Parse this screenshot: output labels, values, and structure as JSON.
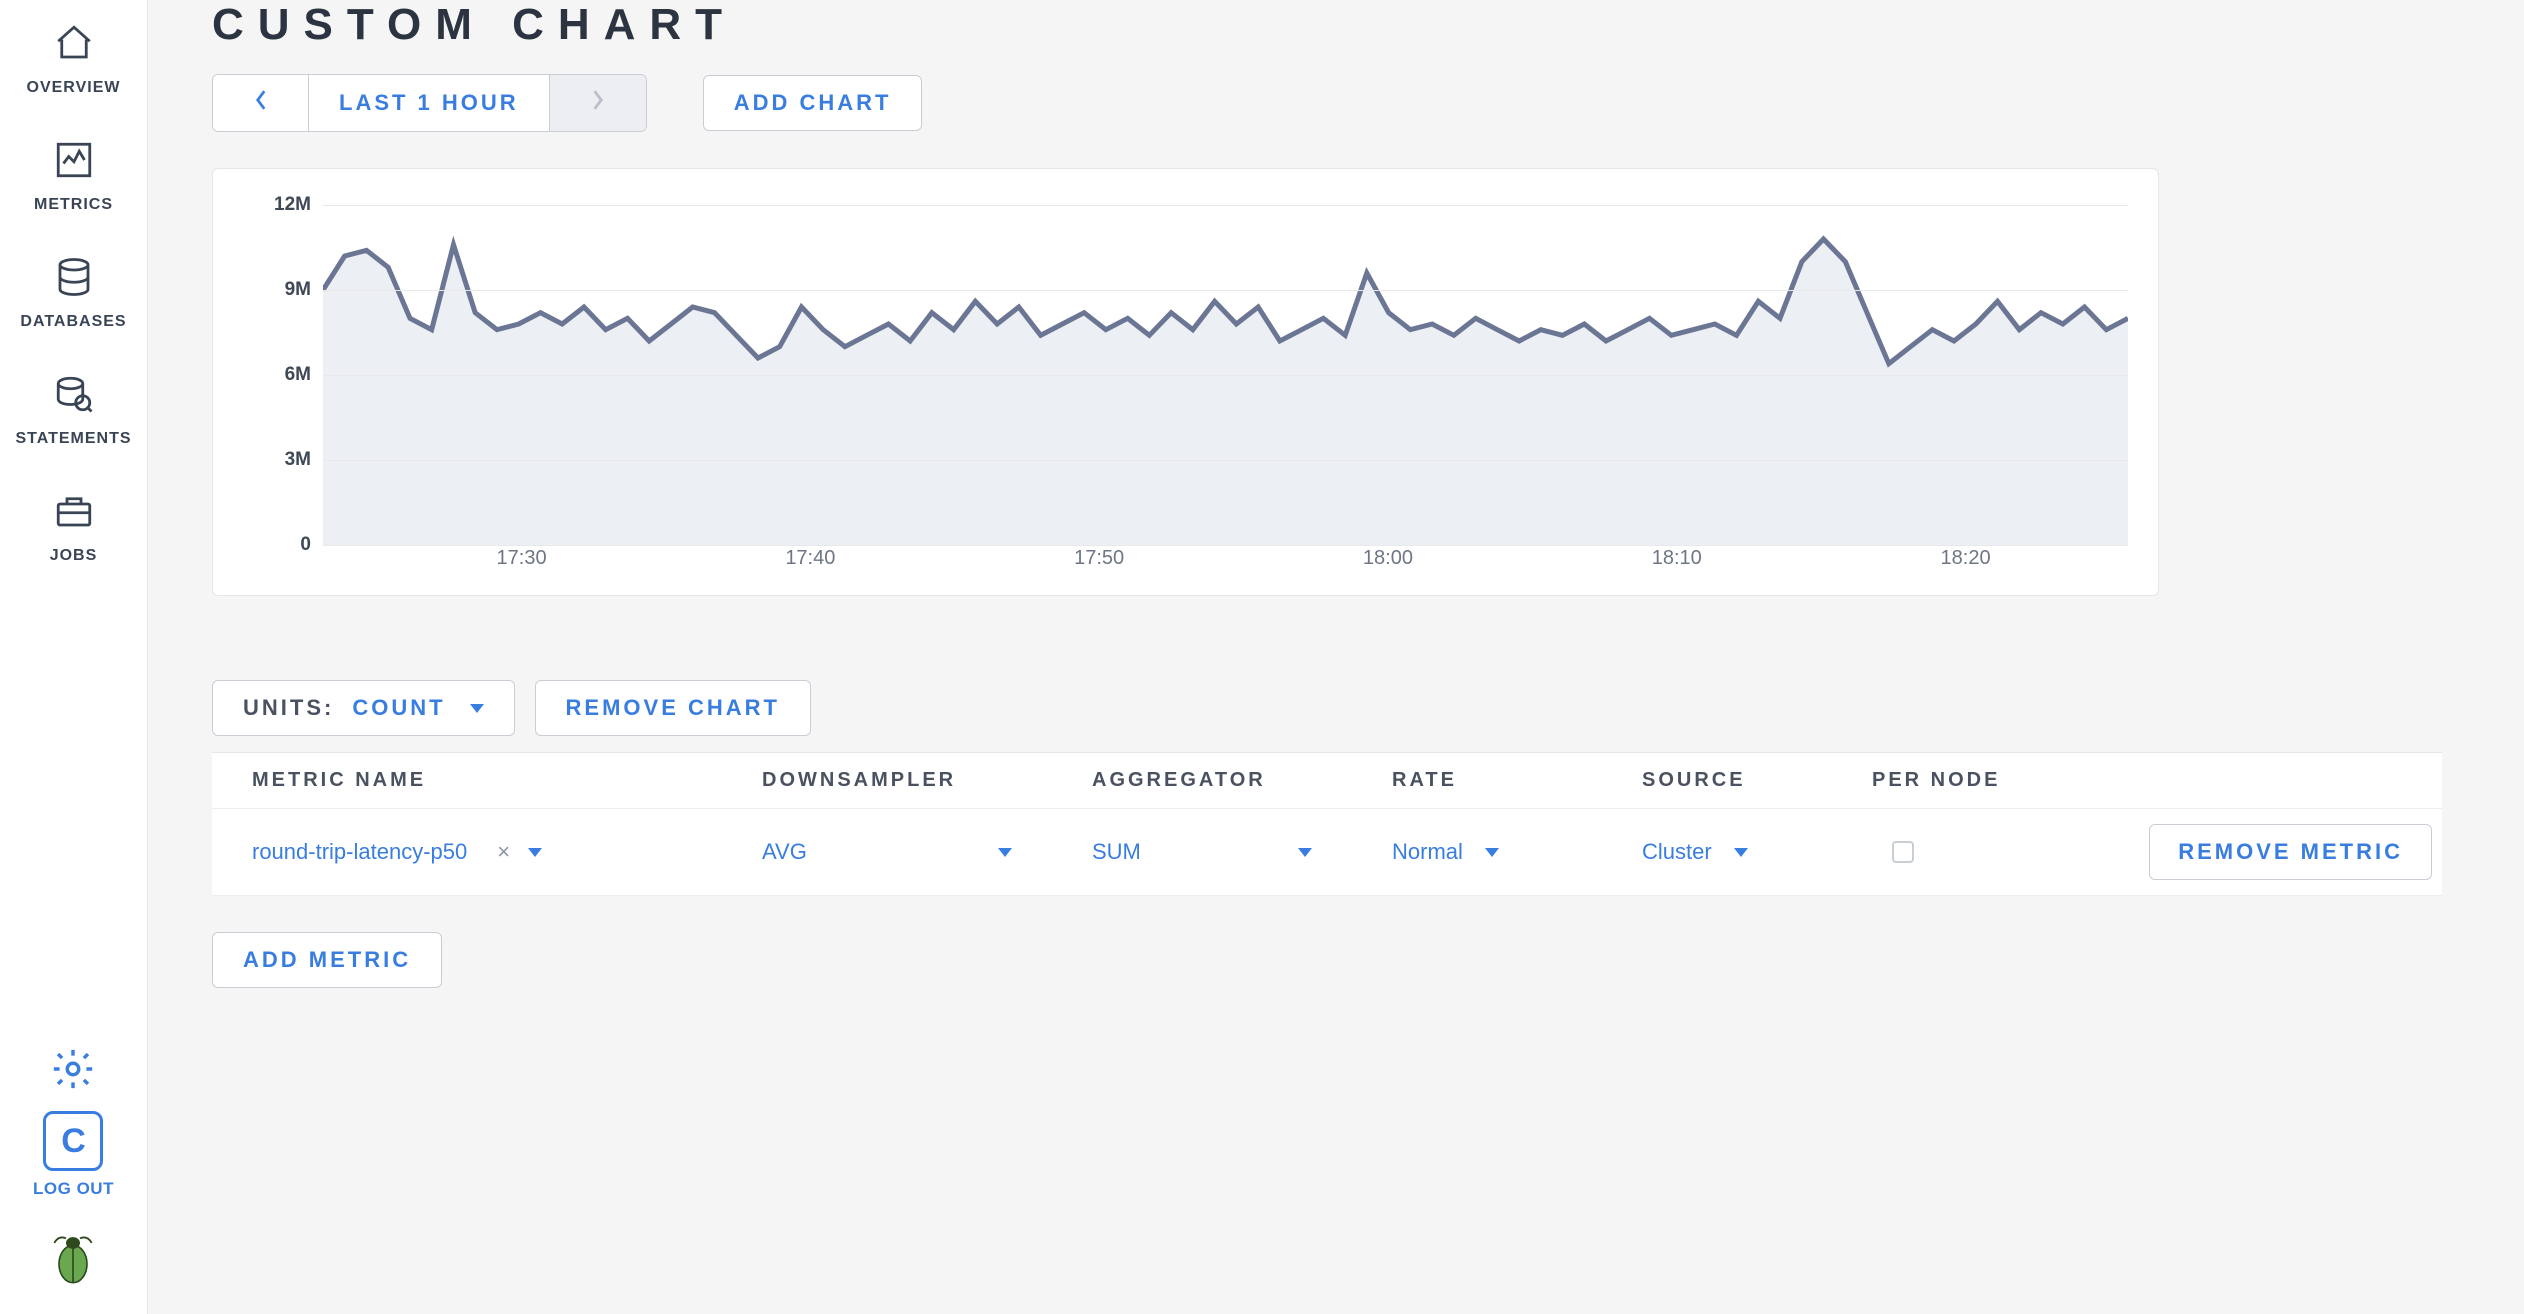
{
  "sidebar": {
    "items": [
      {
        "label": "OVERVIEW"
      },
      {
        "label": "METRICS"
      },
      {
        "label": "DATABASES"
      },
      {
        "label": "STATEMENTS"
      },
      {
        "label": "JOBS"
      }
    ],
    "logout_initial": "C",
    "logout_label": "LOG OUT"
  },
  "page": {
    "title": "CUSTOM CHART",
    "time_range_label": "LAST 1 HOUR",
    "add_chart_label": "ADD CHART",
    "units_label": "UNITS:",
    "units_value": "COUNT",
    "remove_chart_label": "REMOVE CHART",
    "add_metric_label": "ADD METRIC",
    "remove_metric_label": "REMOVE METRIC"
  },
  "table": {
    "headers": {
      "metric_name": "METRIC NAME",
      "downsampler": "DOWNSAMPLER",
      "aggregator": "AGGREGATOR",
      "rate": "RATE",
      "source": "SOURCE",
      "per_node": "PER NODE"
    },
    "rows": [
      {
        "metric_name": "round-trip-latency-p50",
        "downsampler": "AVG",
        "aggregator": "SUM",
        "rate": "Normal",
        "source": "Cluster",
        "per_node": false
      }
    ]
  },
  "chart_data": {
    "type": "line",
    "title": "",
    "xlabel": "",
    "ylabel": "",
    "ylim": [
      0,
      12000000
    ],
    "y_ticks": [
      "0",
      "3M",
      "6M",
      "9M",
      "12M"
    ],
    "x_ticks": [
      "17:30",
      "17:40",
      "17:50",
      "18:00",
      "18:10",
      "18:20"
    ],
    "series": [
      {
        "name": "round-trip-latency-p50",
        "color": "#6b7594",
        "fill": "#eceff4",
        "values": [
          9.0,
          10.2,
          10.4,
          9.8,
          8.0,
          7.6,
          10.6,
          8.2,
          7.6,
          7.8,
          8.2,
          7.8,
          8.4,
          7.6,
          8.0,
          7.2,
          7.8,
          8.4,
          8.2,
          7.4,
          6.6,
          7.0,
          8.4,
          7.6,
          7.0,
          7.4,
          7.8,
          7.2,
          8.2,
          7.6,
          8.6,
          7.8,
          8.4,
          7.4,
          7.8,
          8.2,
          7.6,
          8.0,
          7.4,
          8.2,
          7.6,
          8.6,
          7.8,
          8.4,
          7.2,
          7.6,
          8.0,
          7.4,
          9.6,
          8.2,
          7.6,
          7.8,
          7.4,
          8.0,
          7.6,
          7.2,
          7.6,
          7.4,
          7.8,
          7.2,
          7.6,
          8.0,
          7.4,
          7.6,
          7.8,
          7.4,
          8.6,
          8.0,
          10.0,
          10.8,
          10.0,
          8.2,
          6.4,
          7.0,
          7.6,
          7.2,
          7.8,
          8.6,
          7.6,
          8.2,
          7.8,
          8.4,
          7.6,
          8.0
        ]
      }
    ]
  }
}
